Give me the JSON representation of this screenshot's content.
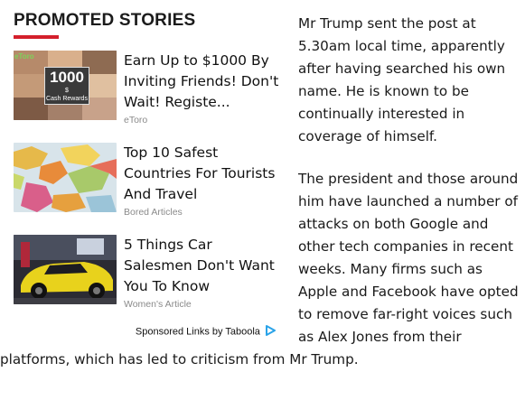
{
  "widget": {
    "heading": "PROMOTED STORIES",
    "accent_color": "#d41f2c",
    "stories": [
      {
        "title": "Earn Up to $1000 By Inviting Friends! Don't Wait! Registe...",
        "source": "eToro",
        "thumb_icon": "faces-grid-image",
        "thumb_badge_amount": "1000",
        "thumb_badge_currency": "$",
        "thumb_badge_caption": "Cash Rewards",
        "thumb_logo": "eToro"
      },
      {
        "title": "Top 10 Safest Countries For Tourists And Travel",
        "source": "Bored Articles",
        "thumb_icon": "world-map-image"
      },
      {
        "title": "5 Things Car Salesmen Don't Want You To Know",
        "source": "Women's Article",
        "thumb_icon": "yellow-car-image"
      }
    ],
    "sponsored_label": "Sponsored Links by Taboola",
    "sponsored_icon": "taboola-play-icon"
  },
  "article": {
    "paragraphs": [
      "Mr Trump sent the post at 5.30am local time, apparently after having searched his own name. He is known to be continually interested in coverage of himself.",
      "The president and those around him have launched a number of attacks on both Google and other tech companies in recent weeks. Many firms such as Apple and Facebook have opted to remove far-right voices such as Alex Jones from their platforms, which has led to criticism from Mr Trump."
    ]
  }
}
